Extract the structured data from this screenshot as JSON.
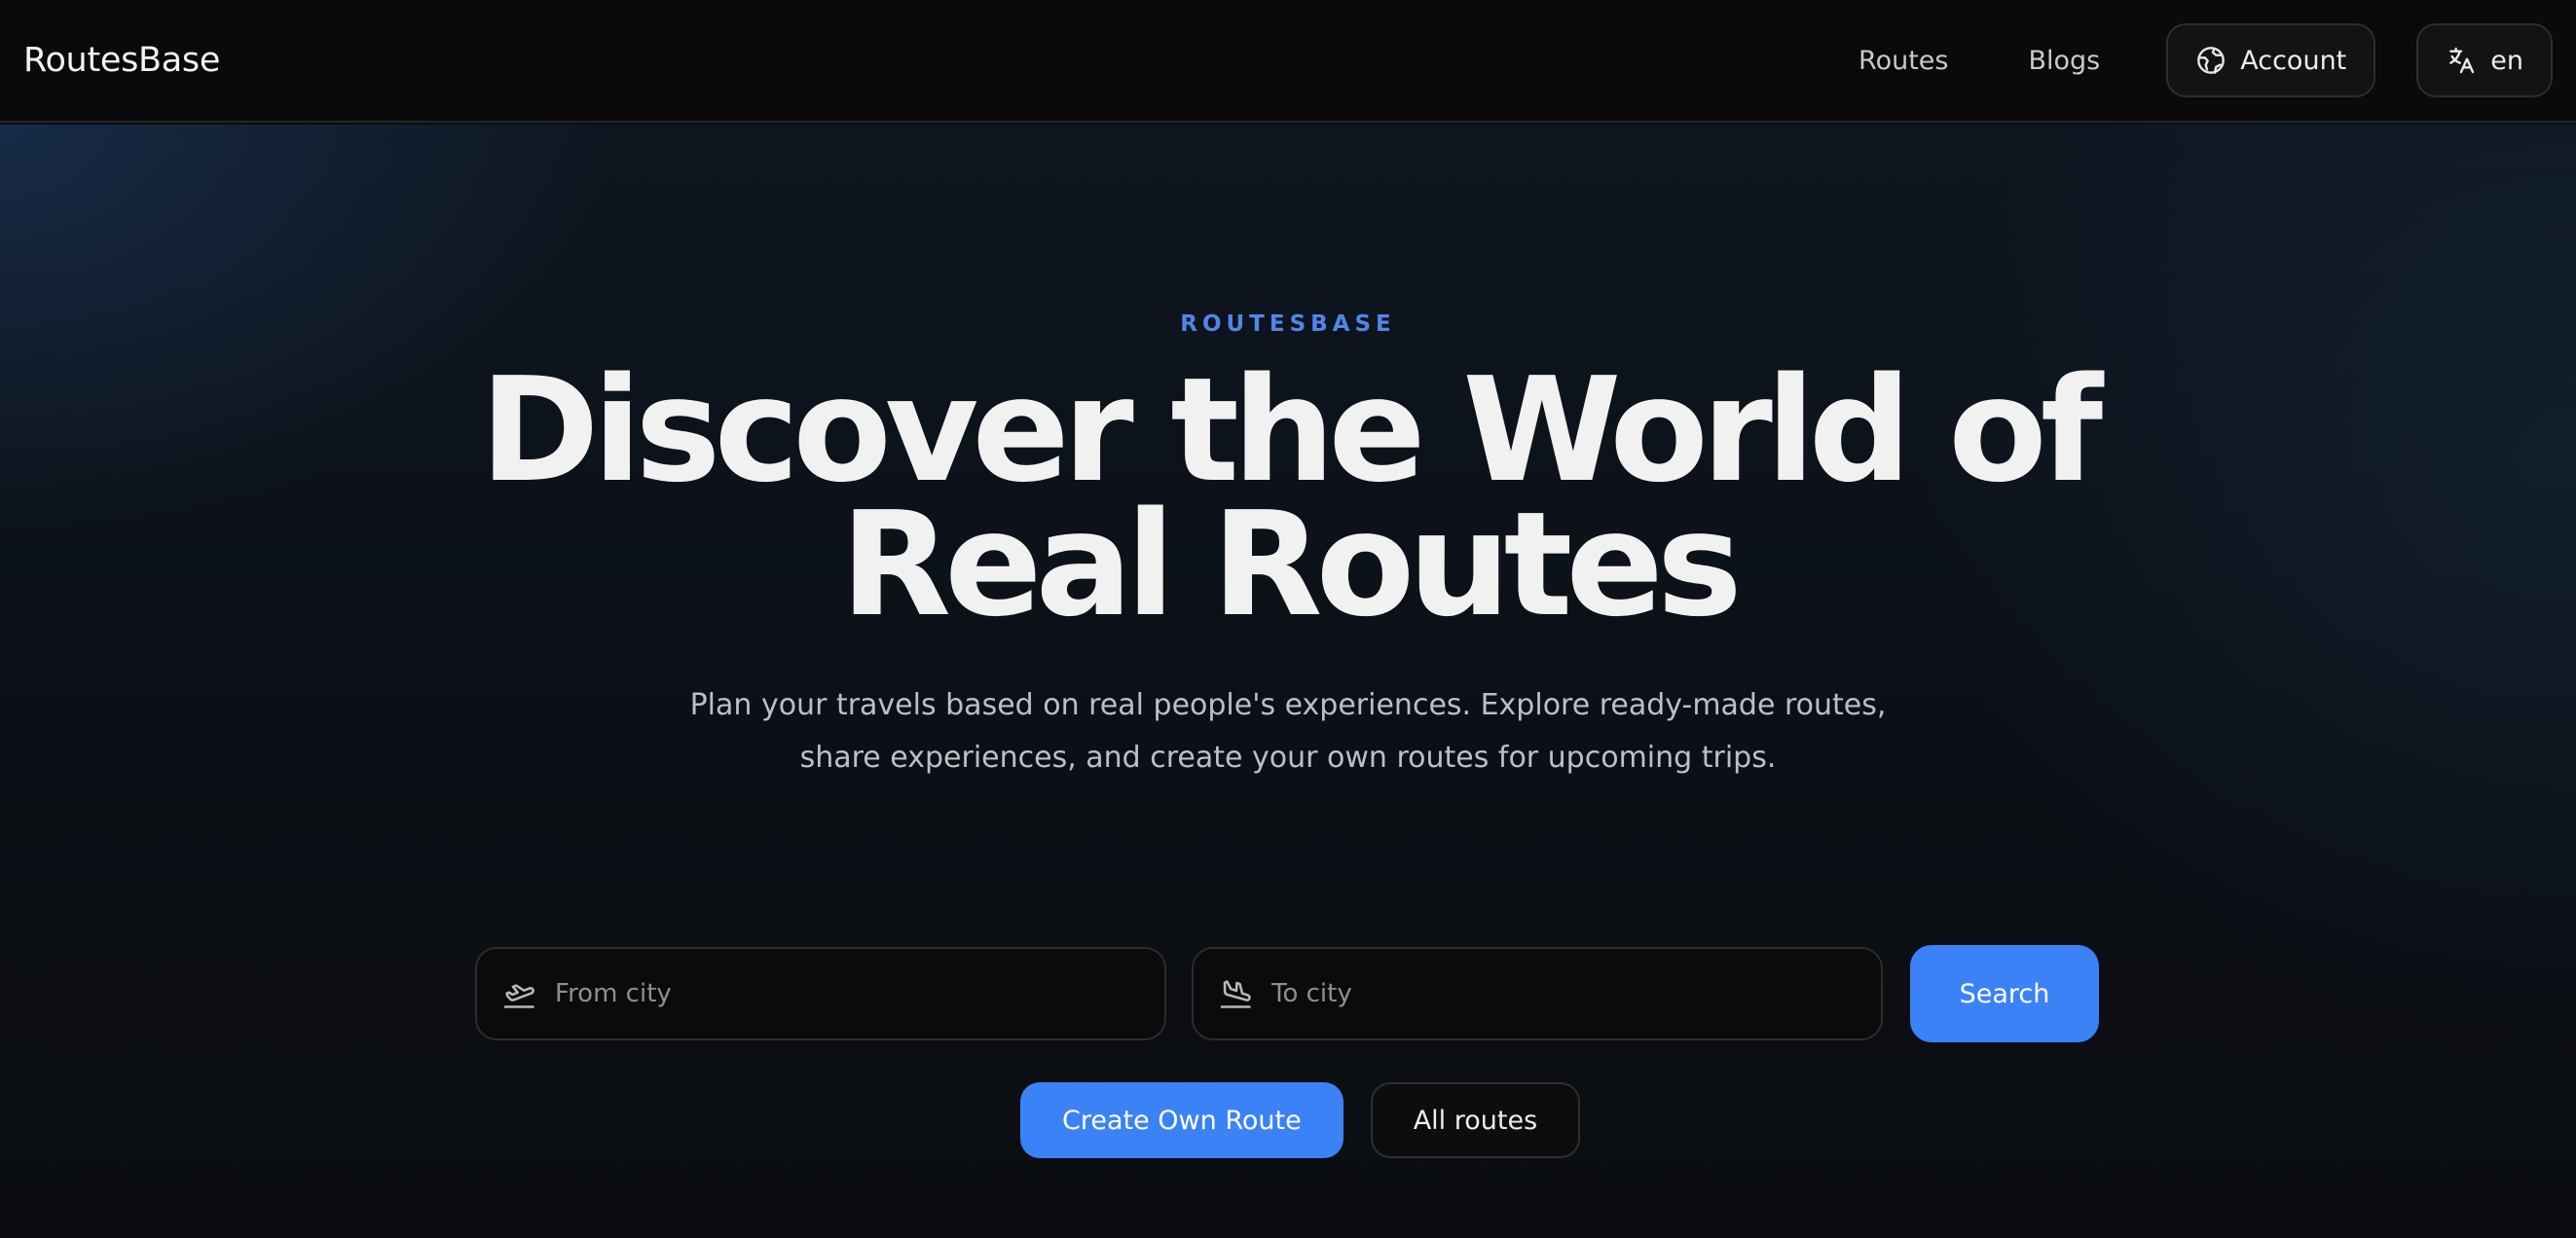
{
  "navbar": {
    "brand": "RoutesBase",
    "links": {
      "routes": "Routes",
      "blogs": "Blogs"
    },
    "account_label": "Account",
    "language_label": "en",
    "icons": {
      "account": "globe-icon",
      "language": "translate-icon"
    }
  },
  "hero": {
    "eyebrow": "ROUTESBASE",
    "headline_line1": "Discover the World of",
    "headline_line2": "Real Routes",
    "subtitle": "Plan your travels based on real people's experiences. Explore ready-made routes, share experiences, and create your own routes for upcoming trips."
  },
  "search": {
    "from_placeholder": "From city",
    "from_value": "",
    "to_placeholder": "To city",
    "to_value": "",
    "button_label": "Search",
    "icons": {
      "from": "plane-departure-icon",
      "to": "plane-arrival-icon"
    }
  },
  "actions": {
    "create_label": "Create Own Route",
    "all_routes_label": "All routes"
  },
  "colors": {
    "accent": "#3b82f6",
    "eyebrow": "#4f86e8",
    "navbar_bg": "#0a0a0a",
    "hero_bg": "#0c1016"
  }
}
